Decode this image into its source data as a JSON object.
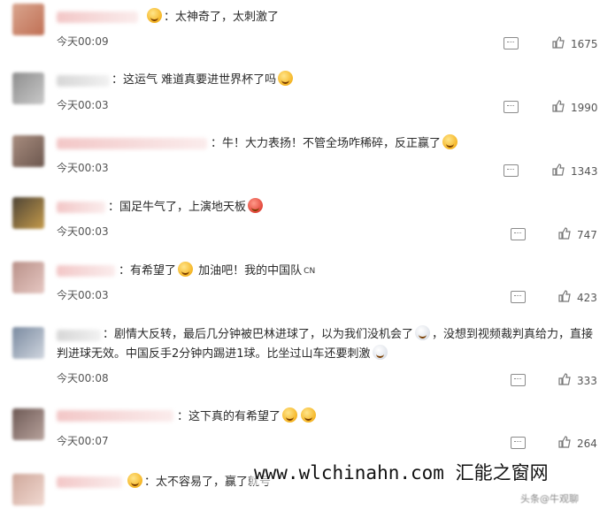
{
  "comments": [
    {
      "text": "：太神奇了，太刺激了",
      "time": "今天00:09",
      "likes": "1675"
    },
    {
      "text": "：这运气 难道真要进世界杯了吗",
      "time": "今天00:03",
      "likes": "1990"
    },
    {
      "text": "：牛！大力表扬！不管全场咋稀碎，反正赢了",
      "time": "今天00:03",
      "likes": "1343"
    },
    {
      "text": "：国足牛气了，上演地天板",
      "time": "今天00:03",
      "likes": "747"
    },
    {
      "text": "：有希望了",
      "text2": "加油吧！我的中国队",
      "flag": "CN",
      "time": "今天00:03",
      "likes": "423"
    },
    {
      "text": "：剧情大反转，最后几分钟被巴林进球了，以为我们没机会了",
      "text2": "，没想到视频裁判真给力，直接判进球无效。中国反手2分钟内踢进1球。比坐过山车还要刺激",
      "time": "今天00:08",
      "likes": "333"
    },
    {
      "text": "：这下真的有希望了",
      "time": "今天00:07",
      "likes": "264"
    },
    {
      "text": "：太不容易了，赢了就号"
    }
  ],
  "watermark": {
    "text": "www.wlchinahn.com 汇能之窗网",
    "tail": "头条@牛观聊"
  },
  "colors": {
    "reply_icon": "#8a8a8a",
    "text": "#2a2a2a"
  }
}
